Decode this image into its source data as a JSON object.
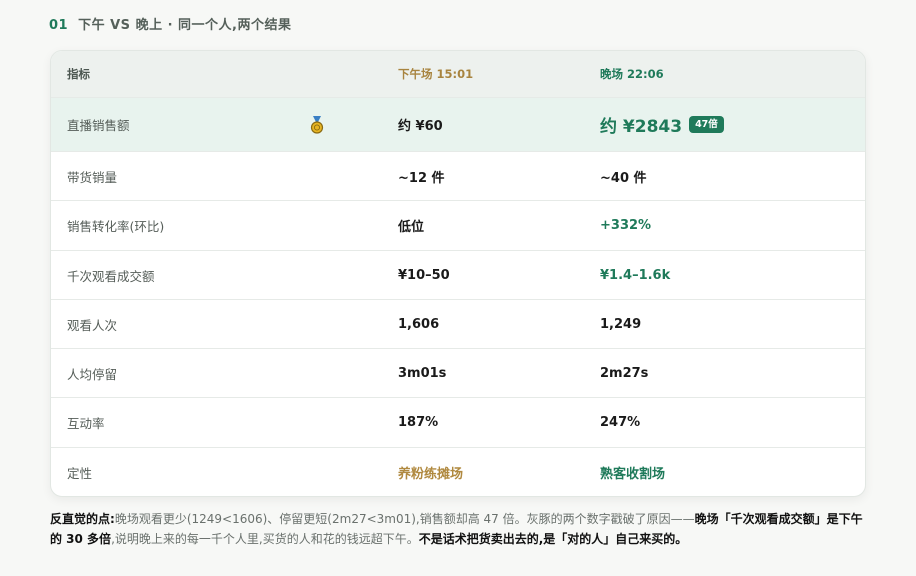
{
  "section": {
    "number": "01",
    "title": "下午 VS 晚上 · 同一个人,两个结果"
  },
  "table": {
    "headers": [
      "指标",
      "下午场 15:01",
      "晚场 22:06"
    ],
    "rows": [
      {
        "metric": "直播销售额",
        "afternoon": "约 ¥60",
        "evening": "约 ¥2843",
        "badge": "47倍",
        "icon": "medal-icon"
      },
      {
        "metric": "带货销量",
        "afternoon": "~12 件",
        "evening": "~40 件"
      },
      {
        "metric": "销售转化率(环比)",
        "afternoon": "低位",
        "evening": "+332%"
      },
      {
        "metric": "千次观看成交额",
        "afternoon": "¥10–50",
        "evening": "¥1.4–1.6k"
      },
      {
        "metric": "观看人次",
        "afternoon": "1,606",
        "evening": "1,249"
      },
      {
        "metric": "人均停留",
        "afternoon": "3m01s",
        "evening": "2m27s"
      },
      {
        "metric": "互动率",
        "afternoon": "187%",
        "evening": "247%"
      },
      {
        "metric": "定性",
        "afternoon": "养粉练摊场",
        "evening": "熟客收割场"
      }
    ]
  },
  "footer": {
    "lead": "反直觉的点:",
    "text1": "晚场观看更少(1249<1606)、停留更短(2m27<3m01),销售额却高 47 倍。灰豚的两个数字戳破了原因——",
    "bold1": "晚场「千次观看成交额」是下午的 30 多倍",
    "text2": ",说明晚上来的每一千个人里,买货的人和花的钱远超下午。",
    "bold2": "不是话术把货卖出去的,是「对的人」自己来买的。"
  },
  "colors": {
    "accent_green": "#1f7a5a",
    "accent_gold": "#b0893f",
    "highlight_row": "#e8f3ee"
  }
}
